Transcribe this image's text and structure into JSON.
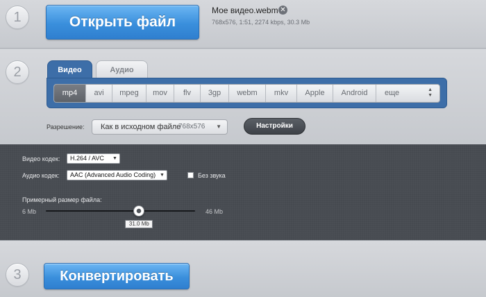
{
  "step1": {
    "number": "1",
    "open_button": "Открыть файл",
    "file_name": "Мое видео.webm",
    "file_meta": "768x576, 1:51, 2274 kbps, 30.3 Mb",
    "close_icon": "✕"
  },
  "step2": {
    "number": "2",
    "tabs": [
      {
        "label": "Видео",
        "active": true
      },
      {
        "label": "Аудио",
        "active": false
      }
    ],
    "formats": [
      "mp4",
      "avi",
      "mpeg",
      "mov",
      "flv",
      "3gp",
      "webm",
      "mkv",
      "Apple",
      "Android",
      "еще"
    ],
    "active_format": "mp4",
    "resolution_label": "Разрешение:",
    "resolution_value": "Как в исходном файле",
    "resolution_dim": "768x576",
    "settings_button": "Настройки"
  },
  "codec": {
    "video_label": "Видео кодек:",
    "video_value": "H.264 / AVC",
    "audio_label": "Аудио кодек:",
    "audio_value": "AAC (Advanced Audio Coding)",
    "mute_label": "Без звука",
    "mute_checked": false,
    "size_label": "Примерный размер файла:",
    "size_min": "6 Mb",
    "size_max": "46 Mb",
    "size_value": "31.0 Mb",
    "size_fraction": 0.625
  },
  "step3": {
    "number": "3",
    "convert_button": "Конвертировать"
  }
}
